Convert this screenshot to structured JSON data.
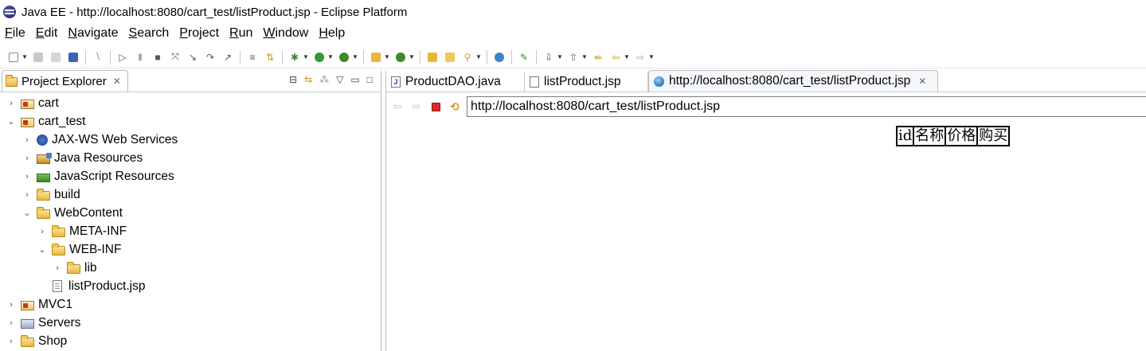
{
  "window": {
    "title": "Java EE - http://localhost:8080/cart_test/listProduct.jsp - Eclipse Platform"
  },
  "menu": [
    {
      "mnemonic": "F",
      "rest": "ile"
    },
    {
      "mnemonic": "E",
      "rest": "dit"
    },
    {
      "mnemonic": "N",
      "rest": "avigate"
    },
    {
      "mnemonic": "S",
      "rest": "earch"
    },
    {
      "mnemonic": "P",
      "rest": "roject"
    },
    {
      "mnemonic": "R",
      "rest": "un"
    },
    {
      "mnemonic": "W",
      "rest": "indow"
    },
    {
      "mnemonic": "H",
      "rest": "elp"
    }
  ],
  "explorer": {
    "tab_label": "Project Explorer",
    "tree": [
      {
        "label": "cart",
        "toggle": "›",
        "icon": "project"
      },
      {
        "label": "cart_test",
        "toggle": "⌄",
        "icon": "project"
      },
      {
        "label": "JAX-WS Web Services",
        "toggle": "›",
        "icon": "jaxws"
      },
      {
        "label": "Java Resources",
        "toggle": "›",
        "icon": "java-resources"
      },
      {
        "label": "JavaScript Resources",
        "toggle": "›",
        "icon": "javascript-resources"
      },
      {
        "label": "build",
        "toggle": "›",
        "icon": "folder"
      },
      {
        "label": "WebContent",
        "toggle": "⌄",
        "icon": "folder"
      },
      {
        "label": "META-INF",
        "toggle": "›",
        "icon": "folder"
      },
      {
        "label": "WEB-INF",
        "toggle": "⌄",
        "icon": "folder"
      },
      {
        "label": "lib",
        "toggle": "›",
        "icon": "folder"
      },
      {
        "label": "listProduct.jsp",
        "toggle": "",
        "icon": "file"
      },
      {
        "label": "MVC1",
        "toggle": "›",
        "icon": "project"
      },
      {
        "label": "Servers",
        "toggle": "›",
        "icon": "servers"
      },
      {
        "label": "Shop",
        "toggle": "›",
        "icon": "folder"
      }
    ]
  },
  "editor": {
    "tabs": [
      {
        "label": "ProductDAO.java",
        "icon_letter": "J"
      },
      {
        "label": "listProduct.jsp",
        "icon_letter": ""
      },
      {
        "label": "http://localhost:8080/cart_test/listProduct.jsp",
        "icon_letter": ""
      }
    ],
    "url": "http://localhost:8080/cart_test/listProduct.jsp"
  },
  "page": {
    "table_headers": [
      "id",
      "名称",
      "价格",
      "购买"
    ]
  },
  "colors": {
    "stop": "#d62d2d",
    "folder": "#e9b63c",
    "active_tab_bg": "#f4f7fb"
  }
}
